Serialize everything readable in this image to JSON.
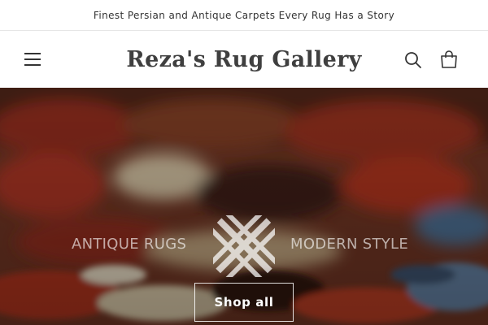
{
  "announcement": {
    "text": "Finest Persian and Antique Carpets Every Rug Has a Story"
  },
  "header": {
    "logo_text": "Reza's Rug Gallery",
    "menu_icon": "hamburger-icon",
    "search_icon": "search-icon",
    "cart_icon": "cart-icon"
  },
  "hero": {
    "tagline_left": "ANTIQUE RUGS",
    "tagline_right": "MODERN STYLE",
    "shop_button_label": "Shop all",
    "colors": {
      "rug_red": "#9e2d1c",
      "rug_dark": "#3a1b12",
      "rug_cream": "#c9b89a",
      "rug_blue": "#4a6a8c"
    }
  }
}
